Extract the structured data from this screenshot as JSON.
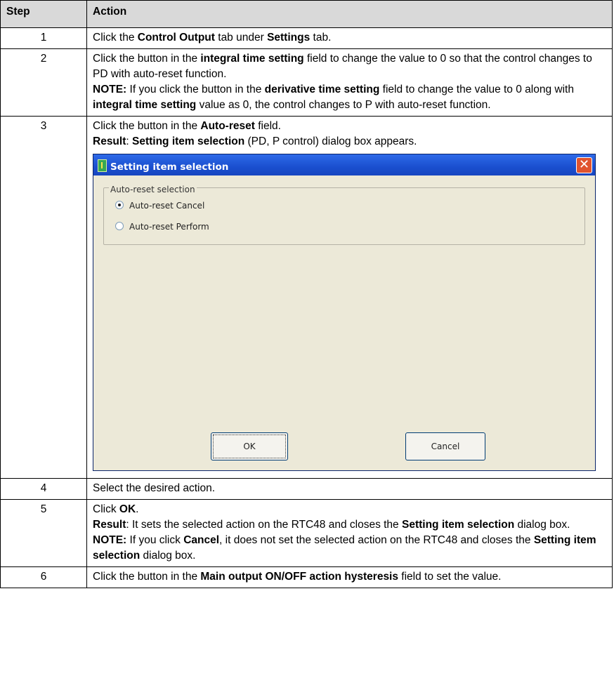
{
  "header": {
    "step": "Step",
    "action": "Action"
  },
  "rows": [
    {
      "step": "1",
      "l1": [
        "Click the ",
        "Control Output",
        " tab under ",
        "Settings",
        " tab."
      ]
    },
    {
      "step": "2",
      "l1": [
        "Click the button in the ",
        "integral time setting",
        " field to change the value to 0 so that the control changes to PD with auto-reset function."
      ],
      "l2": [
        "NOTE:",
        " If you click the button in the ",
        "derivative time setting",
        " field to change the value to 0 along with ",
        "integral time setting",
        " value as 0, the control changes to P with auto-reset function."
      ]
    },
    {
      "step": "3",
      "l1": [
        "Click the button in the ",
        "Auto-reset",
        " field."
      ],
      "l2": [
        "Result",
        ": ",
        "Setting item selection",
        " (PD, P control) dialog box appears."
      ]
    },
    {
      "step": "4",
      "l1": [
        "Select the desired action."
      ]
    },
    {
      "step": "5",
      "l1": [
        "Click ",
        "OK",
        "."
      ],
      "l2": [
        "Result",
        ": It sets the selected action on the RTC48 and closes the ",
        "Setting item selection",
        " dialog box."
      ],
      "l3": [
        "NOTE:",
        " If you click ",
        "Cancel",
        ", it does not set the selected action on the RTC48 and closes the ",
        "Setting item selection",
        " dialog box."
      ]
    },
    {
      "step": "6",
      "l1": [
        "Click the button in the ",
        "Main output ON/OFF action hysteresis",
        " field to set the value."
      ]
    }
  ],
  "dialog": {
    "title": "Setting item selection",
    "group_label": "Auto-reset selection",
    "options": [
      "Auto-reset Cancel",
      "Auto-reset Perform"
    ],
    "selected": "Auto-reset Cancel",
    "ok_label": "OK",
    "cancel_label": "Cancel"
  }
}
